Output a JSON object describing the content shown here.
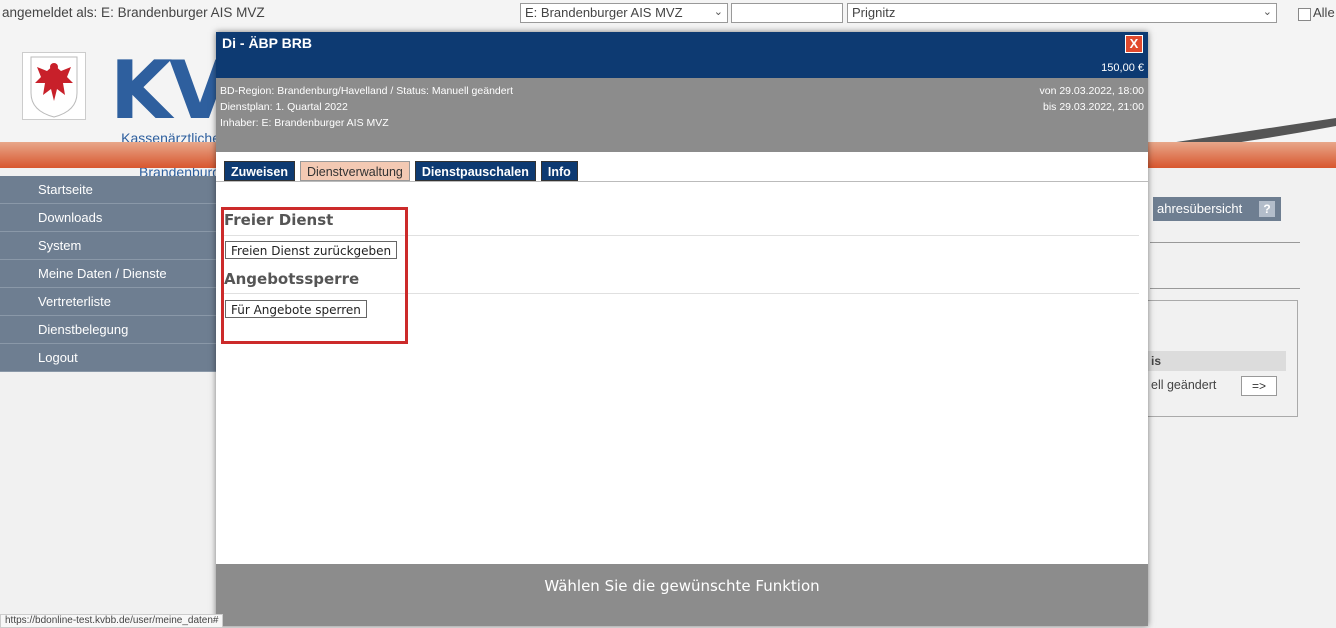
{
  "topbar": {
    "logged_in": "angemeldet als: E: Brandenburger AIS MVZ",
    "select_org": "E: Brandenburger AIS MVZ",
    "select_empty": "",
    "select_region": "Prignitz",
    "checkbox_label": "Alle"
  },
  "logo": {
    "letters": "KVB",
    "subtitle_line1": "Kassenärztliche V",
    "subtitle_line2": "Brandenburg"
  },
  "sidebar": {
    "items": [
      {
        "label": "Startseite"
      },
      {
        "label": "Downloads"
      },
      {
        "label": "System"
      },
      {
        "label": "Meine Daten / Dienste"
      },
      {
        "label": "Vertreterliste"
      },
      {
        "label": "Dienstbelegung"
      },
      {
        "label": "Logout"
      }
    ]
  },
  "background_right": {
    "jahres_btn": "ahresübersicht",
    "help_icon": "?",
    "table_header": "is",
    "row_text": "ell geändert",
    "arrow_btn": "=>"
  },
  "dialog": {
    "title": "Di - ÄBP BRB",
    "close": "X",
    "price": "150,00 €",
    "info_left": [
      "BD-Region: Brandenburg/Havelland / Status: Manuell geändert",
      "Dienstplan: 1. Quartal 2022",
      "Inhaber: E: Brandenburger AIS MVZ"
    ],
    "info_right": [
      "von 29.03.2022, 18:00",
      "bis 29.03.2022, 21:00"
    ],
    "tabs": [
      {
        "label": "Zuweisen",
        "active": false
      },
      {
        "label": "Dienstverwaltung",
        "active": true
      },
      {
        "label": "Dienstpauschalen",
        "active": false
      },
      {
        "label": "Info",
        "active": false
      }
    ],
    "section1_title": "Freier Dienst",
    "section1_button": "Freien Dienst zurückgeben",
    "section2_title": "Angebotssperre",
    "section2_button": "Für Angebote sperren",
    "footer": "Wählen Sie die gewünschte Funktion"
  },
  "status_url": "https://bdonline-test.kvbb.de/user/meine_daten#"
}
